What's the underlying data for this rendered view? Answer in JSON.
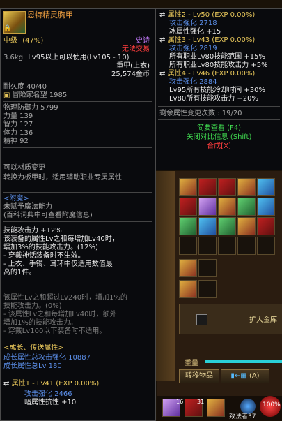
{
  "main_tooltip": {
    "item_name": "恩特精灵胸甲",
    "grade": "中级",
    "grade_pct": "(47%)",
    "rarity": "史诗",
    "trade": "无法交易",
    "weight": "3.6kg",
    "level_req": "Lv95以上可以使用(Lv105 - 10)",
    "armor_type": "重甲(上衣)",
    "price": "25,574金币",
    "durability": "耐久度 40/40",
    "adventurer_fame": "冒险家名望 1985",
    "stats": [
      "物理防御力 5799",
      "力量 139",
      "智力 127",
      "体力 136",
      "精神 92"
    ],
    "material_change_title": "可以材质变更",
    "material_change_desc": "转换为板甲时，适用辅助职业专属属性",
    "enchant_title": "<附魔>",
    "enchant_status": "未赋予魔法能力",
    "enchant_hint": "(百科词典中可查看附魔信息)",
    "skill_lines": [
      "技能攻击力 +12%",
      "该装备的属性Lv之和每增加Lv40时，",
      "增加3%的技能攻击力。(12%)",
      "- 穿戴神话装备时不生效。",
      "- 上衣、手镯、耳环中仅适用数值最",
      "高的1件。"
    ],
    "inactive_lines": [
      "该属性Lv之和超过Lv240时，增加1%的",
      "技能攻击力。(0%)",
      "- 该属性Lv之和每增加Lv40时，额外",
      "增加1%的技能攻击力。",
      "- 穿戴Lv100以下装备时不适用。"
    ],
    "growth_title": "<成长、传送属性>",
    "growth_attack": "成长属性总攻击强化 10887",
    "growth_lv": "成长属性总Lv 180",
    "attr1_title": "属性1 - Lv41 (EXP 0.00%)",
    "attr1_lines": [
      "攻击强化 2466",
      "暗属性抗性 +10"
    ]
  },
  "side_tooltip": {
    "attr2_title": "属性2 - Lv50 (EXP 0.00%)",
    "attr2_lines": [
      "攻击强化 2718",
      "冰属性强化 +15"
    ],
    "attr3_title": "属性3 - Lv43 (EXP 0.00%)",
    "attr3_lines": [
      "攻击强化 2819",
      "所有职业Lv80技能范围 +15%",
      "所有职业Lv80技能攻击力 +5%"
    ],
    "attr4_title": "属性4 - Lv46 (EXP 0.00%)",
    "attr4_lines": [
      "攻击强化 2884",
      "Lv95所有技能冷却时间 +30%",
      "Lv80所有技能攻击力 +20%"
    ],
    "remaining": "剩余属性变更次数 : 19/20",
    "brief_view": "简要查看 (F4)",
    "close_compare": "关闭对比信息 (Shift)",
    "synth": "合成[X]"
  },
  "inventory": {
    "expand_label": "扩大金库",
    "weight_label": "重量",
    "move_items": "转移物品",
    "sort_label": "(A)",
    "gold_display": "致法者37",
    "percent": "100%",
    "item_counts": [
      "16",
      "31"
    ]
  },
  "colors": {
    "gold": "#e7c65a",
    "red": "#ff3d3d",
    "green": "#3fd84f",
    "orange": "#f0a040",
    "blue": "#5b8ee8"
  }
}
